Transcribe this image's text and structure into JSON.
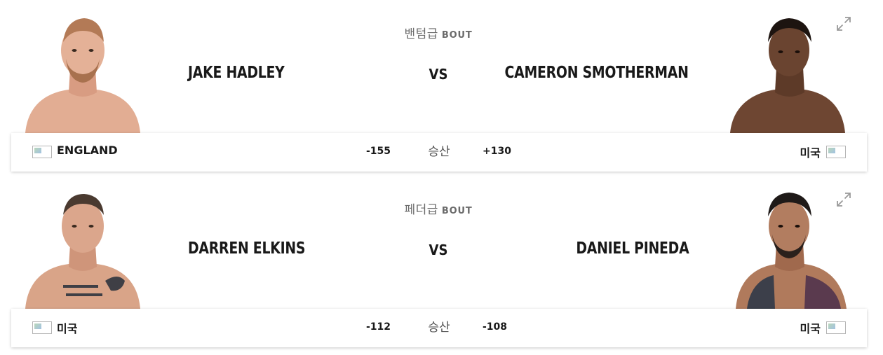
{
  "bouts": [
    {
      "weight_class": "밴텀급",
      "bout_label": "BOUT",
      "vs_label": "VS",
      "red": {
        "name": "JAKE HADLEY",
        "country": "ENGLAND",
        "odds": "-155"
      },
      "blue": {
        "name": "CAMERON SMOTHERMAN",
        "country": "미국",
        "odds": "+130"
      },
      "odds_label": "승산"
    },
    {
      "weight_class": "페더급",
      "bout_label": "BOUT",
      "vs_label": "VS",
      "red": {
        "name": "DARREN ELKINS",
        "country": "미국",
        "odds": "-112"
      },
      "blue": {
        "name": "DANIEL PINEDA",
        "country": "미국",
        "odds": "-108"
      },
      "odds_label": "승산"
    }
  ],
  "icons": {
    "expand": "expand-arrows-icon",
    "flag": "flag-icon"
  },
  "colors": {
    "text": "#191919",
    "muted": "#6b6b6b",
    "background": "#ffffff"
  }
}
